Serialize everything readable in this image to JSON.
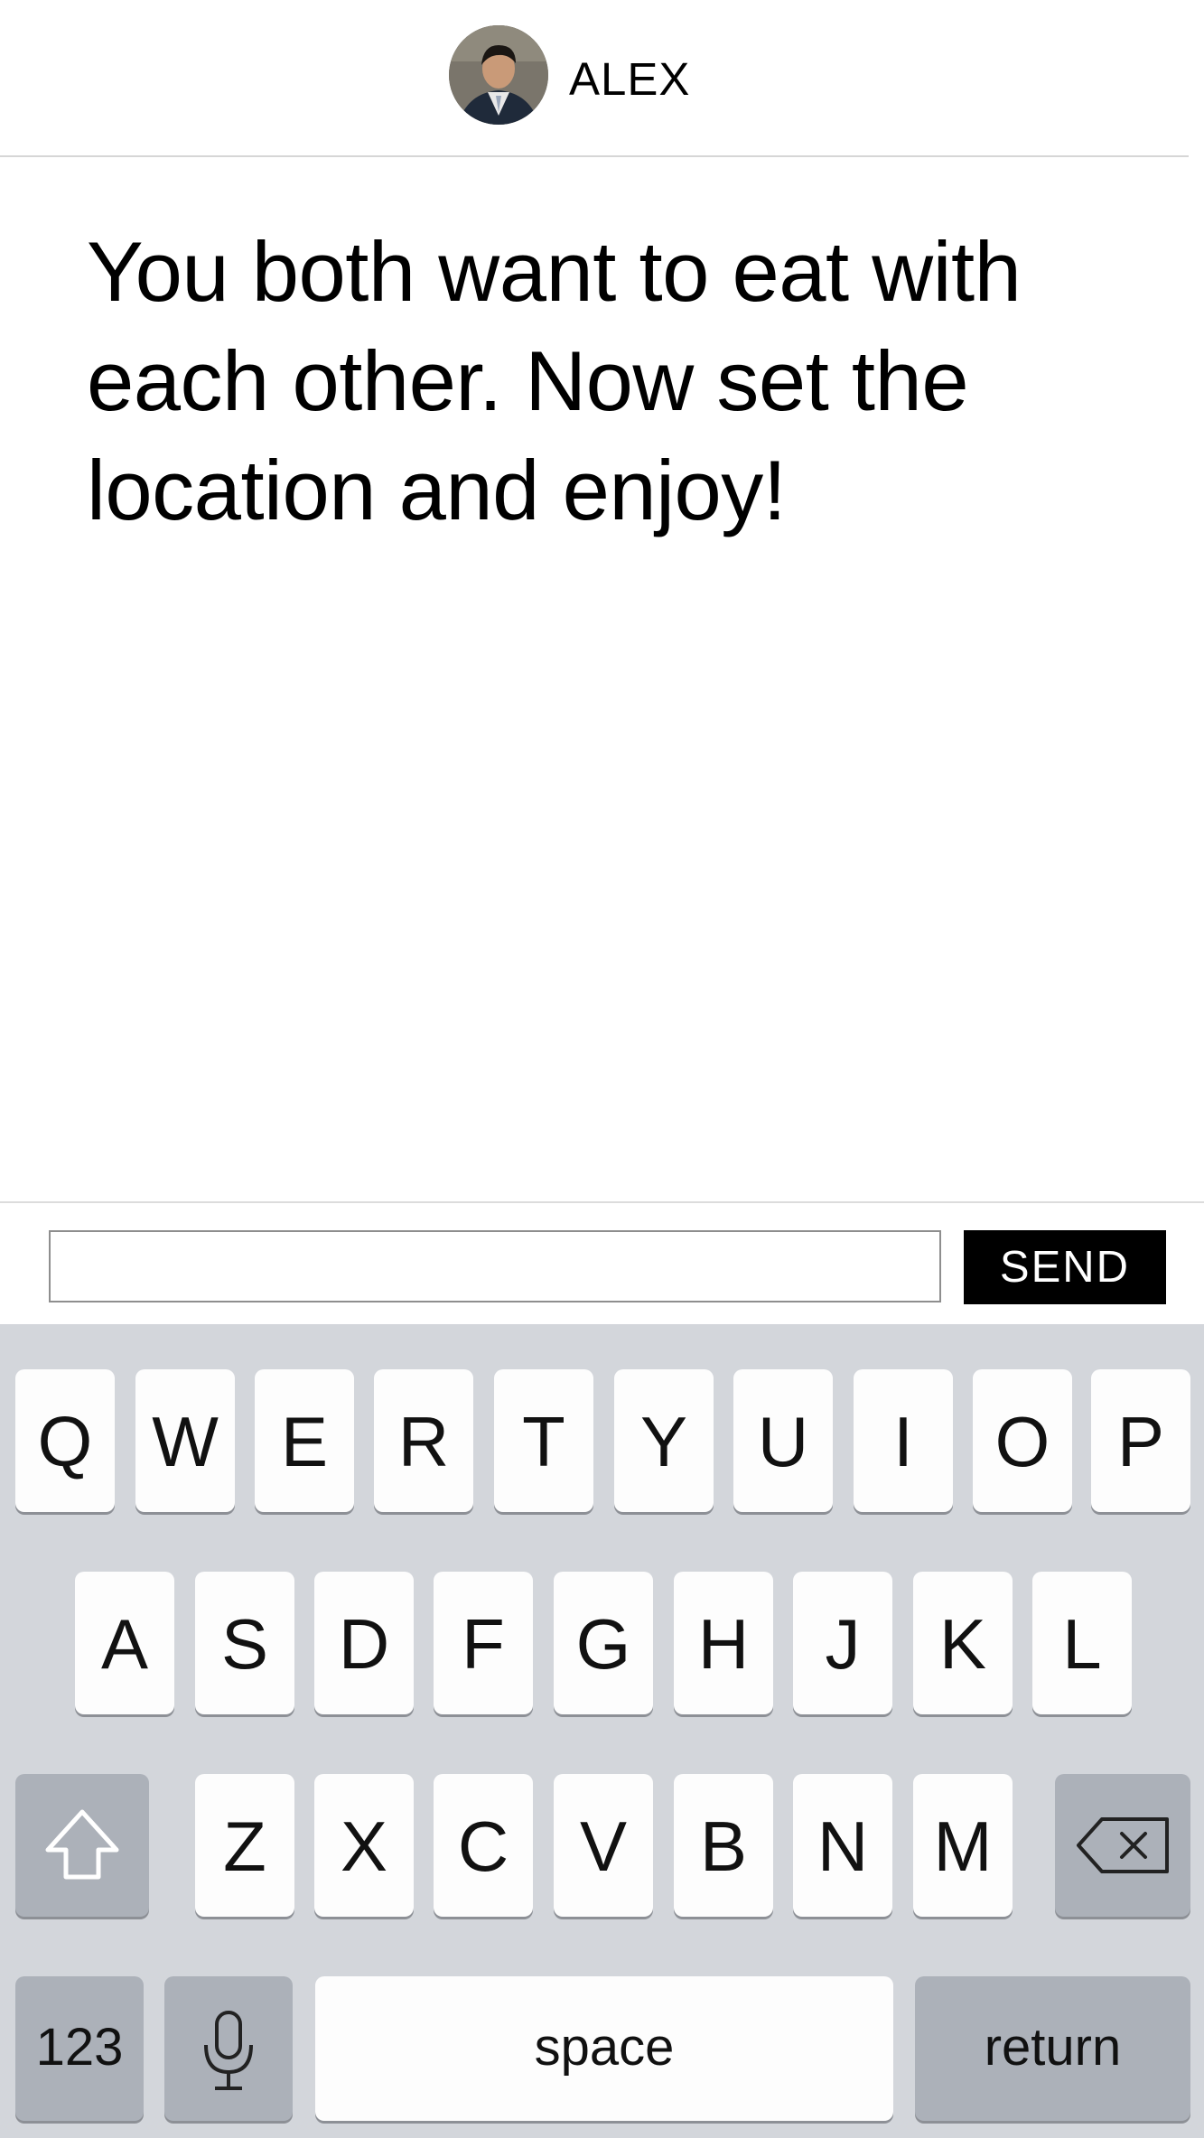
{
  "header": {
    "contact_name": "ALEX",
    "avatar_icon": "avatar-photo"
  },
  "message": {
    "text": "You both want to eat with each other. Now set the location and enjoy!"
  },
  "compose": {
    "input_value": "",
    "input_placeholder": "",
    "send_label": "SEND"
  },
  "keyboard": {
    "row1": [
      "Q",
      "W",
      "E",
      "R",
      "T",
      "Y",
      "U",
      "I",
      "O",
      "P"
    ],
    "row2": [
      "A",
      "S",
      "D",
      "F",
      "G",
      "H",
      "J",
      "K",
      "L"
    ],
    "row3": [
      "Z",
      "X",
      "C",
      "V",
      "B",
      "N",
      "M"
    ],
    "shift_icon": "shift-icon",
    "delete_icon": "backspace-icon",
    "numbers_label": "123",
    "mic_icon": "microphone-icon",
    "space_label": "space",
    "return_label": "return"
  },
  "colors": {
    "send_button_bg": "#000000",
    "keyboard_bg": "#d3d6db",
    "key_bg": "#fdfdfd",
    "function_key_bg": "#acb1b9"
  }
}
